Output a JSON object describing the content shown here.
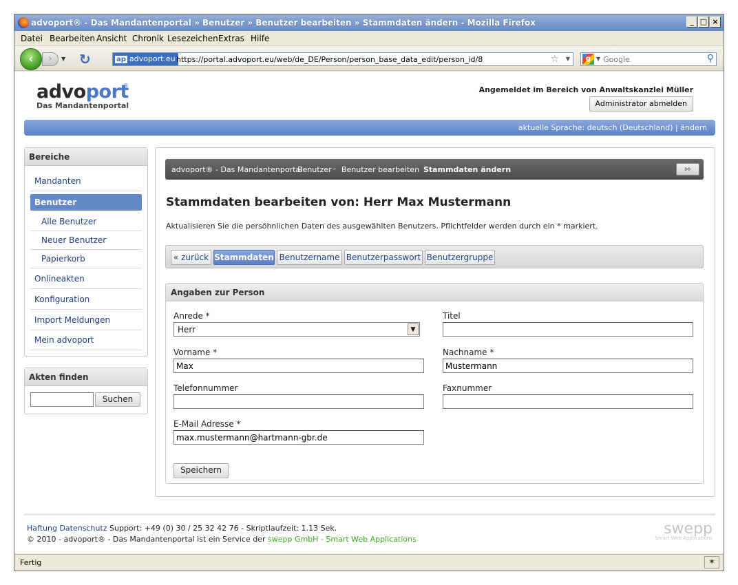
{
  "window": {
    "title": "advoport® - Das Mandantenportal » Benutzer » Benutzer bearbeiten » Stammdaten ändern - Mozilla Firefox",
    "minimize": "_",
    "maximize": "□",
    "close": "×"
  },
  "menu": [
    "Datei",
    "Bearbeiten",
    "Ansicht",
    "Chronik",
    "Lesezeichen",
    "Extras",
    "Hilfe"
  ],
  "nav": {
    "site_badge": "ap",
    "site_name": "advoport.eu",
    "url": "https://portal.advoport.eu/web/de_DE/Person/person_base_data_edit/person_id/8",
    "search_placeholder": "Google"
  },
  "header": {
    "logo_part1": "advo",
    "logo_part2": "port",
    "logo_reg": "®",
    "tagline": "Das Mandantenportal",
    "login_info": "Angemeldet im Bereich von Anwaltskanzlei Müller",
    "logout_button": "Administrator abmelden",
    "language_bar": "aktuelle Sprache: deutsch (Deutschland) | ändern"
  },
  "sidebar": {
    "heading": "Bereiche",
    "items": [
      {
        "label": "Mandanten"
      },
      {
        "label": "Benutzer"
      },
      {
        "label": "Alle Benutzer"
      },
      {
        "label": "Neuer Benutzer"
      },
      {
        "label": "Papierkorb"
      },
      {
        "label": "Onlineakten"
      },
      {
        "label": "Konfiguration"
      },
      {
        "label": "Import Meldungen"
      },
      {
        "label": "Mein advoport"
      }
    ]
  },
  "search": {
    "heading": "Akten finden",
    "button": "Suchen",
    "value": ""
  },
  "breadcrumb": {
    "items": [
      "advoport® - Das Mandantenportal",
      "Benutzer",
      "Benutzer bearbeiten",
      "Stammdaten ändern"
    ],
    "separator": "»"
  },
  "main": {
    "title": "Stammdaten bearbeiten von: Herr Max Mustermann",
    "description": "Aktualisieren Sie die persöhnlichen Daten des ausgewählten Benutzers. Pflichtfelder werden durch ein * markiert.",
    "tabs": [
      {
        "label": "« zurück"
      },
      {
        "label": "Stammdaten"
      },
      {
        "label": "Benutzername"
      },
      {
        "label": "Benutzerpasswort"
      },
      {
        "label": "Benutzergruppe"
      }
    ]
  },
  "form": {
    "heading": "Angaben zur Person",
    "anrede_label": "Anrede *",
    "anrede_value": "Herr",
    "titel_label": "Titel",
    "titel_value": "",
    "vorname_label": "Vorname *",
    "vorname_value": "Max",
    "nachname_label": "Nachname *",
    "nachname_value": "Mustermann",
    "telefon_label": "Telefonnummer",
    "telefon_value": "",
    "fax_label": "Faxnummer",
    "fax_value": "",
    "email_label": "E-Mail Adresse *",
    "email_value": "max.mustermann@hartmann-gbr.de",
    "save_button": "Speichern"
  },
  "footer": {
    "haftung": "Haftung",
    "datenschutz": "Datenschutz",
    "support": "Support: +49 (0) 30 / 25 32 42 76 - Skriptlaufzeit: 1.13 Sek.",
    "copyright": "© 2010 - advoport® - Das Mandantenportal ist ein Service der",
    "company": "swepp GmbH - Smart Web Applications",
    "logo": "swepp",
    "logo_sub": "Smart Web Applications"
  },
  "status": {
    "text": "Fertig"
  }
}
